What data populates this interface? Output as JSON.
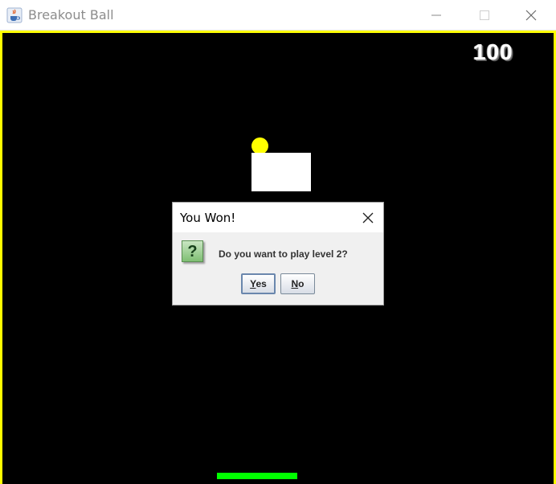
{
  "window": {
    "title": "Breakout Ball",
    "icon": "java-coffee-icon",
    "controls": [
      "minimize-icon",
      "maximize-icon",
      "close-icon"
    ]
  },
  "game": {
    "score": "100",
    "colors": {
      "background": "#000000",
      "border": "#ffff00",
      "ball": "#ffff00",
      "brick": "#ffffff",
      "paddle": "#00ff00"
    }
  },
  "dialog": {
    "title": "You Won!",
    "icon": "question-icon",
    "message": "Do you want to play level 2?",
    "yes_mnemonic": "Y",
    "yes_rest": "es",
    "no_mnemonic": "N",
    "no_rest": "o"
  }
}
